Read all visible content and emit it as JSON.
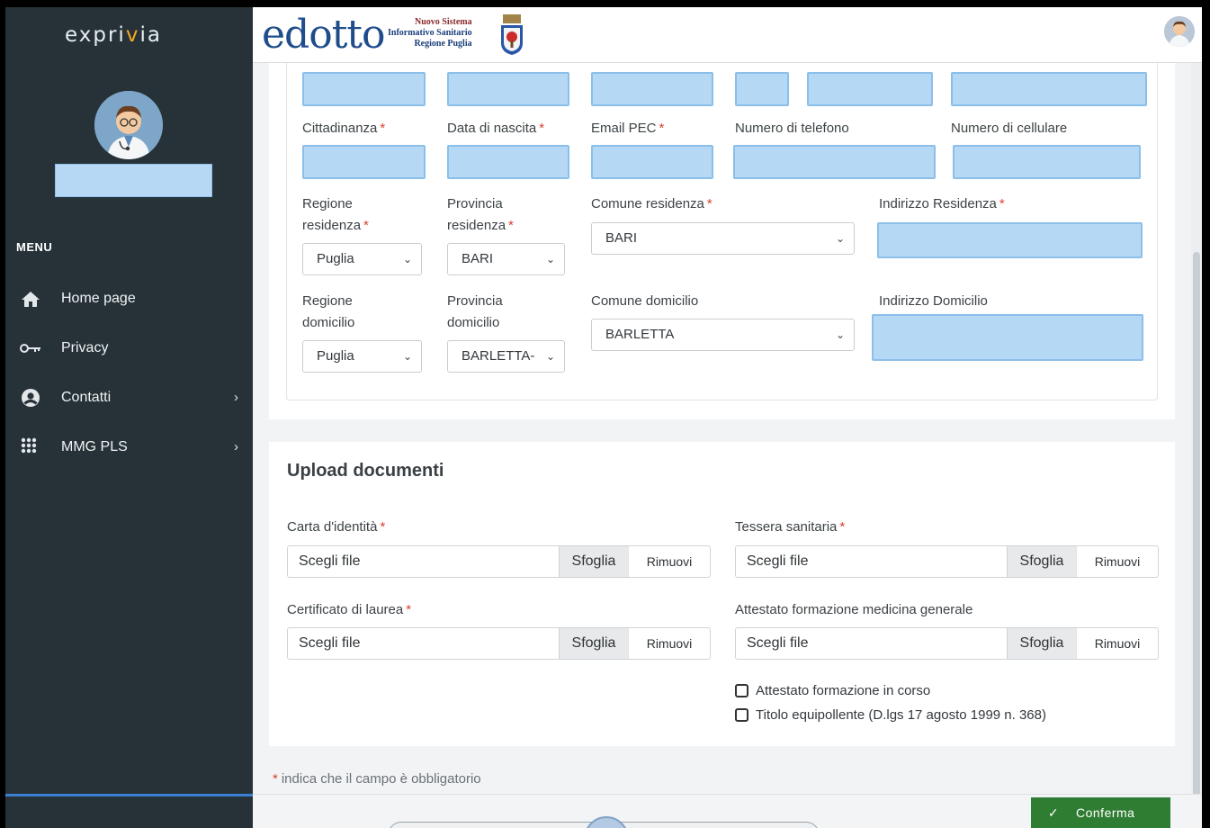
{
  "sidebar": {
    "logo_prefix": "expr",
    "logo_mid": "i",
    "logo_accent": "v",
    "logo_suffix": "ia",
    "menu_title": "MENU",
    "items": [
      {
        "label": "Home page",
        "icon": "home-icon",
        "has_submenu": false
      },
      {
        "label": "Privacy",
        "icon": "key-icon",
        "has_submenu": false
      },
      {
        "label": "Contatti",
        "icon": "user-circle-icon",
        "has_submenu": true
      },
      {
        "label": "MMG PLS",
        "icon": "grid-icon",
        "has_submenu": true
      }
    ],
    "submenu_chevron": "›"
  },
  "header": {
    "brand": "edotto",
    "sub_line1": "Nuovo Sistema",
    "sub_line2": "Informativo Sanitario",
    "sub_line3": "Regione Puglia"
  },
  "personal": {
    "labels": {
      "cittadinanza": "Cittadinanza",
      "data_nascita": "Data di nascita",
      "email_pec": "Email PEC",
      "telefono": "Numero di telefono",
      "cellulare": "Numero di cellulare",
      "regione_residenza": "Regione residenza",
      "provincia_residenza": "Provincia residenza",
      "comune_residenza": "Comune residenza",
      "indirizzo_residenza": "Indirizzo Residenza",
      "regione_domicilio": "Regione domicilio",
      "provincia_domicilio": "Provincia domicilio",
      "comune_domicilio": "Comune domicilio",
      "indirizzo_domicilio": "Indirizzo Domicilio"
    },
    "values": {
      "regione_residenza": "Puglia",
      "provincia_residenza": "BARI",
      "comune_residenza": "BARI",
      "regione_domicilio": "Puglia",
      "provincia_domicilio": "BARLETTA-",
      "comune_domicilio": "BARLETTA"
    },
    "required_mark": "*",
    "select_chevron": "⌄"
  },
  "upload": {
    "title": "Upload documenti",
    "fields": [
      {
        "label": "Carta d'identità",
        "required": true
      },
      {
        "label": "Tessera sanitaria",
        "required": true
      },
      {
        "label": "Certificato di laurea",
        "required": true
      },
      {
        "label": "Attestato formazione medicina generale",
        "required": false
      }
    ],
    "choose_text": "Scegli file",
    "browse_label": "Sfoglia",
    "remove_label": "Rimuovi",
    "checkboxes": [
      {
        "label": "Attestato formazione in corso",
        "checked": false
      },
      {
        "label": "Titolo equipollente (D.lgs 17 agosto 1999 n. 368)",
        "checked": false
      }
    ]
  },
  "footer": {
    "required_mark": "*",
    "required_note": "indica che il campo è obbligatorio",
    "confirm_label": "Conferma",
    "confirm_icon": "check-icon",
    "confirm_glyph": "✓"
  },
  "colors": {
    "sidebar_bg": "#263238",
    "accent_orange": "#f6a823",
    "brand_blue": "#1f4d8c",
    "required_red": "#d9412f",
    "confirm_green": "#2e7d32",
    "highlight_blue": "#b5d9f5"
  }
}
